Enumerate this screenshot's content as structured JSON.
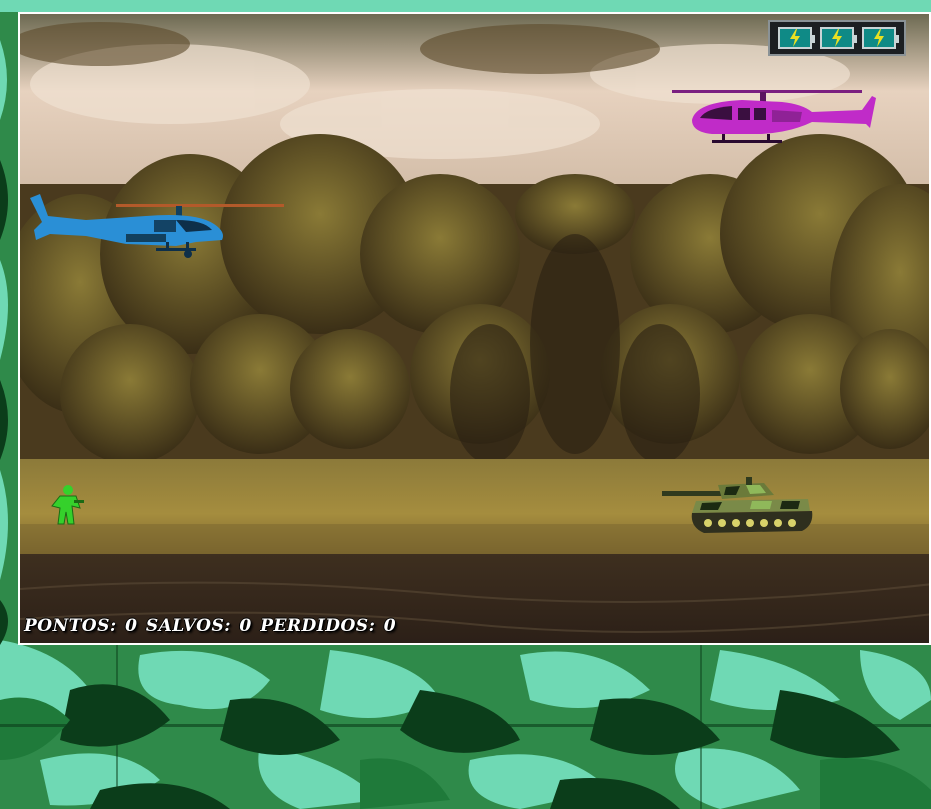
{
  "hud": {
    "score_label": "PONTOS:",
    "score_value": "0",
    "saved_label": "SALVOS:",
    "saved_value": "0",
    "lost_label": "PERDIDOS:",
    "lost_value": "0"
  },
  "energy": {
    "cells": 3,
    "icon": "lightning-bolt-icon",
    "cell_color": "#0f8a86",
    "bolt_color": "#e8e022"
  },
  "sprites": {
    "player_helicopter": "apache-helicopter",
    "enemy_helicopter": "pink-helicopter",
    "friend": "green-soldier",
    "ground_unit": "camouflage-tank"
  },
  "colors": {
    "camo_dark": "#0b3d1a",
    "camo_mid": "#1f7a3a",
    "camo_light": "#6fd9b4",
    "player_helicopter": "#2a8fd6",
    "enemy_helicopter": "#c02bc8",
    "soldier": "#35d12b"
  }
}
